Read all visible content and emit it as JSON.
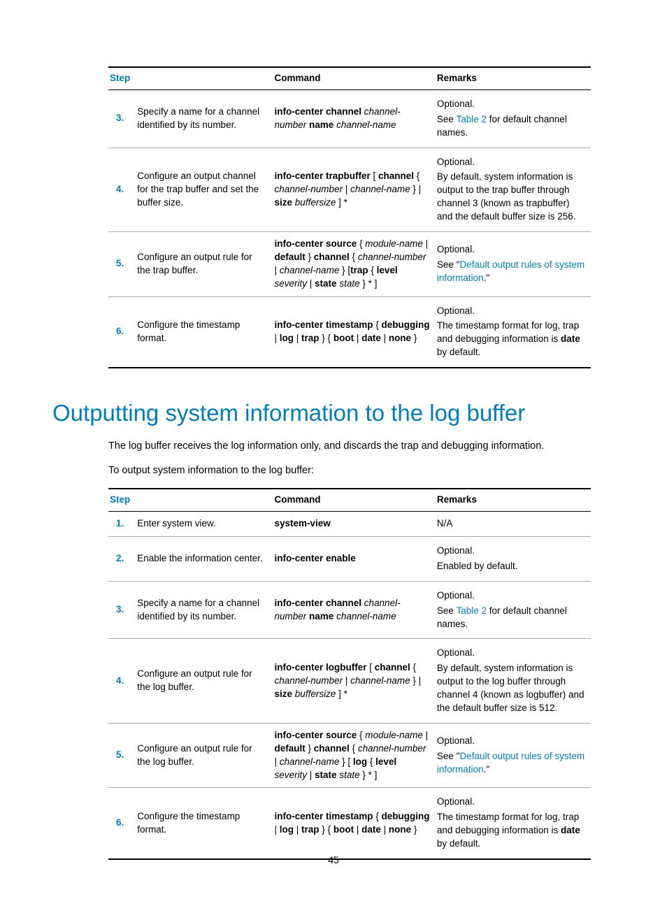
{
  "page_number": "45",
  "section_heading": "Outputting system information to the log buffer",
  "intro_paragraph": "The log buffer receives the log information only, and discards the trap and debugging information.",
  "intro_lead": "To output system information to the log buffer:",
  "columns": {
    "step": "Step",
    "command": "Command",
    "remarks": "Remarks"
  },
  "shared": {
    "optional": "Optional.",
    "na": "N/A",
    "see_prefix": "See ",
    "table2_link": "Table 2",
    "table2_suffix": " for default channel names.",
    "see_quote_prefix": "See \"",
    "default_rules_link": "Default output rules of system information",
    "default_rules_suffix": ".\"",
    "enabled_default": "Enabled by default.",
    "timestamp_remark_a": "The timestamp format for log, trap and debugging information is ",
    "timestamp_remark_b": "date",
    "timestamp_remark_c": " by default."
  },
  "table1": {
    "rows": [
      {
        "num": "3.",
        "desc": "Specify a name for a channel identified by its number.",
        "cmd": {
          "parts": [
            {
              "t": "info-center channel ",
              "b": true
            },
            {
              "t": "channel-number ",
              "i": true
            },
            {
              "t": "name ",
              "b": true
            },
            {
              "t": "channel-name",
              "i": true
            }
          ]
        },
        "rem_type": "table2"
      },
      {
        "num": "4.",
        "desc": "Configure an output channel for the trap buffer and set the buffer size.",
        "cmd": {
          "parts": [
            {
              "t": "info-center trapbuffer",
              "b": true
            },
            {
              "t": " [ "
            },
            {
              "t": "channel",
              "b": true
            },
            {
              "t": " { "
            },
            {
              "t": "channel-number",
              "i": true
            },
            {
              "t": " | "
            },
            {
              "t": "channel-name",
              "i": true
            },
            {
              "t": " } | "
            },
            {
              "t": "size",
              "b": true
            },
            {
              "t": " "
            },
            {
              "t": "buffersize",
              "i": true
            },
            {
              "t": " ] *"
            }
          ]
        },
        "rem_type": "plain",
        "rem_plain": "By default, system information is output to the trap buffer through channel 3 (known as trapbuffer) and the default buffer size is 256."
      },
      {
        "num": "5.",
        "desc": "Configure an output rule for the trap buffer.",
        "cmd": {
          "parts": [
            {
              "t": "info-center source",
              "b": true
            },
            {
              "t": " { "
            },
            {
              "t": "module-name",
              "i": true
            },
            {
              "t": " | "
            },
            {
              "t": "default",
              "b": true
            },
            {
              "t": " } "
            },
            {
              "t": "channel",
              "b": true
            },
            {
              "t": " { "
            },
            {
              "t": "channel-number",
              "i": true
            },
            {
              "t": " | "
            },
            {
              "t": "channel-name",
              "i": true
            },
            {
              "t": " } ["
            },
            {
              "t": "trap",
              "b": true
            },
            {
              "t": " { "
            },
            {
              "t": "level",
              "b": true
            },
            {
              "t": " "
            },
            {
              "t": "severity",
              "i": true
            },
            {
              "t": " | "
            },
            {
              "t": "state",
              "b": true
            },
            {
              "t": " "
            },
            {
              "t": "state",
              "i": true
            },
            {
              "t": " } * ]"
            }
          ]
        },
        "rem_type": "rules"
      },
      {
        "num": "6.",
        "desc": "Configure the timestamp format.",
        "cmd": {
          "parts": [
            {
              "t": "info-center timestamp",
              "b": true
            },
            {
              "t": " { "
            },
            {
              "t": "debugging",
              "b": true
            },
            {
              "t": " | "
            },
            {
              "t": "log",
              "b": true
            },
            {
              "t": " | "
            },
            {
              "t": "trap",
              "b": true
            },
            {
              "t": " } { "
            },
            {
              "t": "boot",
              "b": true
            },
            {
              "t": " | "
            },
            {
              "t": "date",
              "b": true
            },
            {
              "t": " | "
            },
            {
              "t": "none",
              "b": true
            },
            {
              "t": " }"
            }
          ]
        },
        "rem_type": "timestamp"
      }
    ]
  },
  "table2": {
    "rows": [
      {
        "num": "1.",
        "desc": "Enter system view.",
        "cmd": {
          "parts": [
            {
              "t": "system-view",
              "b": true
            }
          ]
        },
        "rem_type": "na"
      },
      {
        "num": "2.",
        "desc": "Enable the information center.",
        "cmd": {
          "parts": [
            {
              "t": "info-center enable",
              "b": true
            }
          ]
        },
        "rem_type": "enabled"
      },
      {
        "num": "3.",
        "desc": "Specify a name for a channel identified by its number.",
        "cmd": {
          "parts": [
            {
              "t": "info-center channel ",
              "b": true
            },
            {
              "t": "channel-number ",
              "i": true
            },
            {
              "t": "name ",
              "b": true
            },
            {
              "t": "channel-name",
              "i": true
            }
          ]
        },
        "rem_type": "table2"
      },
      {
        "num": "4.",
        "desc": "Configure an output rule for the log buffer.",
        "cmd": {
          "parts": [
            {
              "t": "info-center logbuffer",
              "b": true
            },
            {
              "t": " [ "
            },
            {
              "t": "channel",
              "b": true
            },
            {
              "t": " { "
            },
            {
              "t": "channel-number",
              "i": true
            },
            {
              "t": " | "
            },
            {
              "t": "channel-name",
              "i": true
            },
            {
              "t": " } | "
            },
            {
              "t": "size",
              "b": true
            },
            {
              "t": " "
            },
            {
              "t": "buffersize",
              "i": true
            },
            {
              "t": " ] *"
            }
          ]
        },
        "rem_type": "plain",
        "rem_plain": "By default, system information is output to the log buffer through channel 4 (known as logbuffer) and the default buffer size is 512."
      },
      {
        "num": "5.",
        "desc": "Configure an output rule for the log buffer.",
        "cmd": {
          "parts": [
            {
              "t": "info-center source",
              "b": true
            },
            {
              "t": " { "
            },
            {
              "t": "module-name",
              "i": true
            },
            {
              "t": " | "
            },
            {
              "t": "default",
              "b": true
            },
            {
              "t": " } "
            },
            {
              "t": "channel",
              "b": true
            },
            {
              "t": " { "
            },
            {
              "t": "channel-number",
              "i": true
            },
            {
              "t": " | "
            },
            {
              "t": "channel-name",
              "i": true
            },
            {
              "t": " } [ "
            },
            {
              "t": "log",
              "b": true
            },
            {
              "t": " { "
            },
            {
              "t": "level",
              "b": true
            },
            {
              "t": " "
            },
            {
              "t": "severity",
              "i": true
            },
            {
              "t": " | "
            },
            {
              "t": "state",
              "b": true
            },
            {
              "t": " "
            },
            {
              "t": "state",
              "i": true
            },
            {
              "t": " } * ]"
            }
          ]
        },
        "rem_type": "rules"
      },
      {
        "num": "6.",
        "desc": "Configure the timestamp format.",
        "cmd": {
          "parts": [
            {
              "t": "info-center timestamp",
              "b": true
            },
            {
              "t": " { "
            },
            {
              "t": "debugging",
              "b": true
            },
            {
              "t": " | "
            },
            {
              "t": "log",
              "b": true
            },
            {
              "t": " | "
            },
            {
              "t": "trap",
              "b": true
            },
            {
              "t": " } { "
            },
            {
              "t": "boot",
              "b": true
            },
            {
              "t": " | "
            },
            {
              "t": "date",
              "b": true
            },
            {
              "t": " | "
            },
            {
              "t": "none",
              "b": true
            },
            {
              "t": " }"
            }
          ]
        },
        "rem_type": "timestamp"
      }
    ]
  }
}
